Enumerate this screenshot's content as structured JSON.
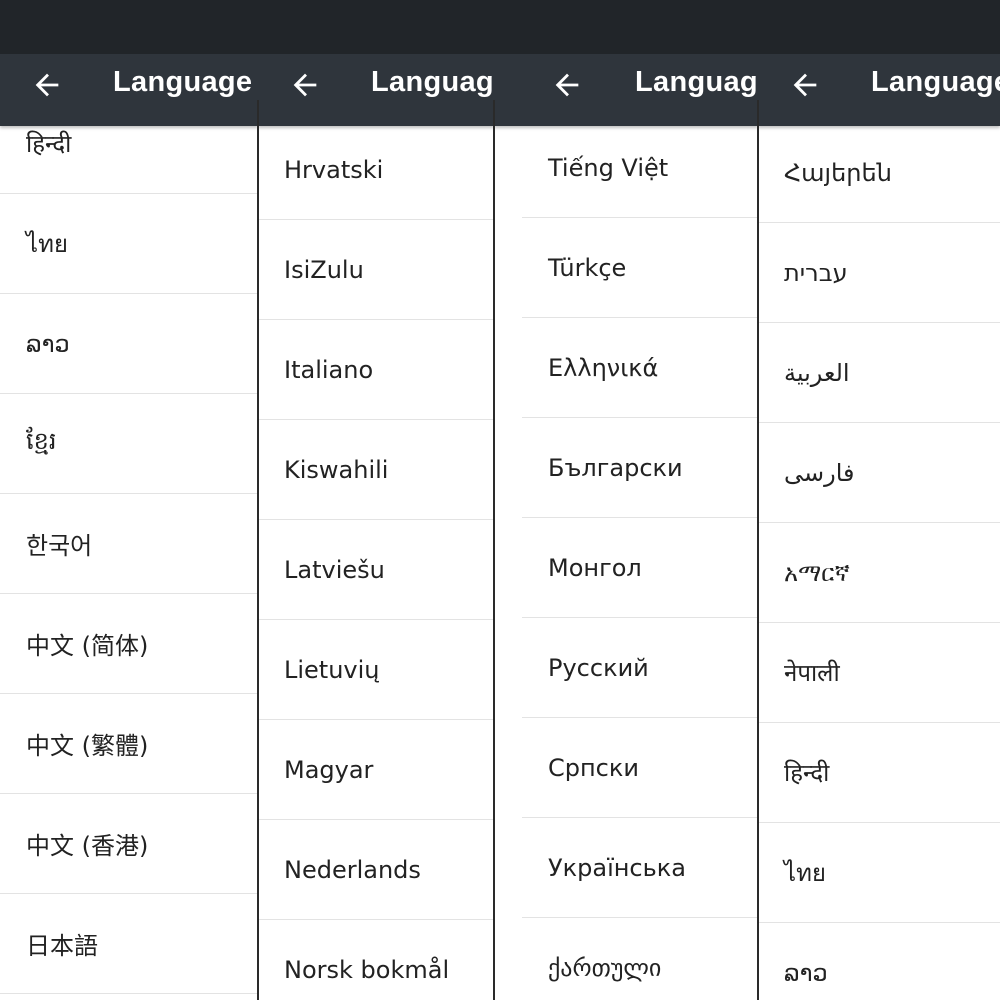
{
  "panels": [
    {
      "title": "Language",
      "items": [
        "हिन्दी",
        "ไทย",
        "ລາວ",
        "ខ្មែរ",
        "한국어",
        "中文 (简体)",
        "中文 (繁體)",
        "中文 (香港)",
        "日本語"
      ]
    },
    {
      "title": "Language",
      "items": [
        "Hrvatski",
        "IsiZulu",
        "Italiano",
        "Kiswahili",
        "Latviešu",
        "Lietuvių",
        "Magyar",
        "Nederlands",
        "Norsk bokmål"
      ]
    },
    {
      "title": "Language",
      "items": [
        "Tiếng Việt",
        "Türkçe",
        "Ελληνικά",
        "Български",
        "Монгол",
        "Русский",
        "Српски",
        "Українська",
        "ქართული"
      ]
    },
    {
      "title": "Language",
      "items": [
        "Հայերեն",
        "עברית",
        "العربية",
        "فارسی",
        "አማርኛ",
        "नेपाली",
        "हिन्दी",
        "ไทย",
        "ລາວ"
      ]
    }
  ],
  "icons": {
    "back": "arrow-left-icon"
  },
  "colors": {
    "statusbar": "#212529",
    "appbar": "#2f353c",
    "text": "#222222"
  }
}
